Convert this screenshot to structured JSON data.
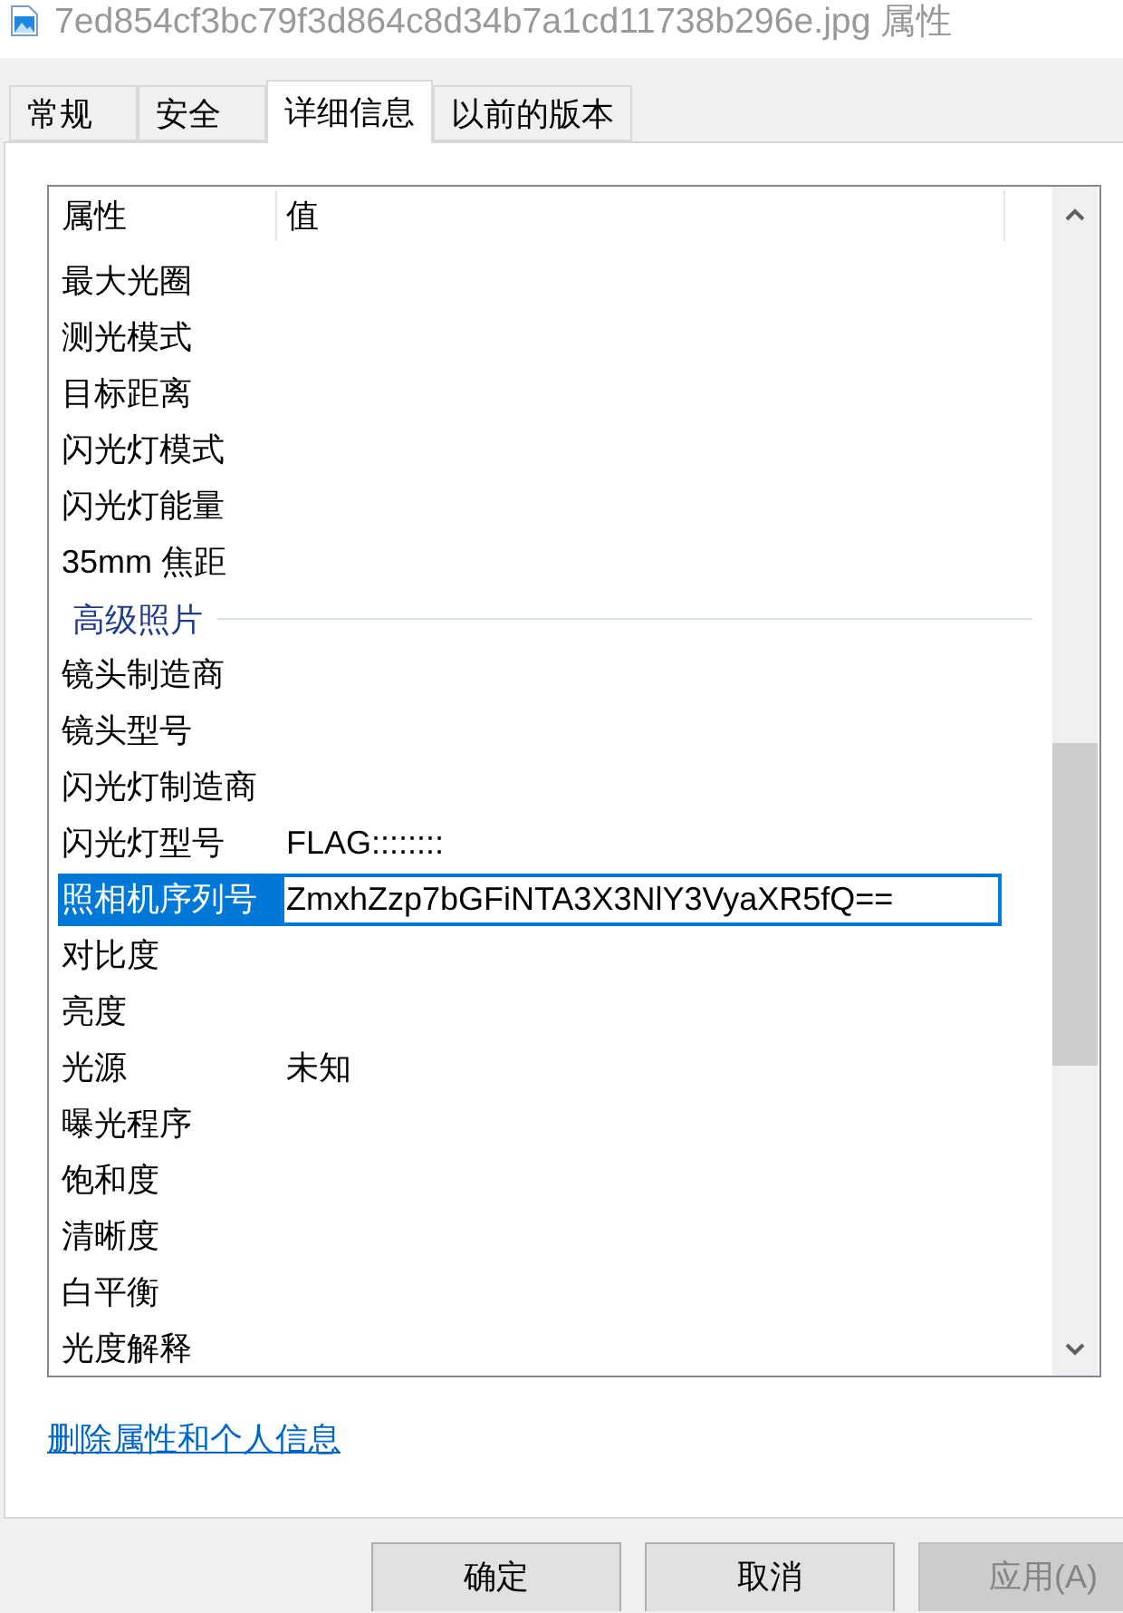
{
  "window": {
    "title": "7ed854cf3bc79f3d864c8d34b7a1cd11738b296e.jpg 属性"
  },
  "tabs": [
    {
      "label": "常规",
      "selected": false
    },
    {
      "label": "安全",
      "selected": false
    },
    {
      "label": "详细信息",
      "selected": true
    },
    {
      "label": "以前的版本",
      "selected": false
    }
  ],
  "property_list": {
    "columns": [
      "属性",
      "值"
    ],
    "rows": [
      {
        "kind": "property",
        "name": "最大光圈",
        "selected": false
      },
      {
        "kind": "property",
        "name": "测光模式",
        "selected": false
      },
      {
        "kind": "property",
        "name": "目标距离",
        "selected": false
      },
      {
        "kind": "property",
        "name": "闪光灯模式",
        "selected": false
      },
      {
        "kind": "property",
        "name": "闪光灯能量",
        "selected": false
      },
      {
        "kind": "property",
        "name": "35mm 焦距",
        "selected": false
      },
      {
        "kind": "group",
        "name": "高级照片"
      },
      {
        "kind": "property",
        "name": "镜头制造商",
        "selected": false
      },
      {
        "kind": "property",
        "name": "镜头型号",
        "selected": false
      },
      {
        "kind": "property",
        "name": "闪光灯制造商",
        "selected": false
      },
      {
        "kind": "property",
        "name": "闪光灯型号",
        "value": "FLAG::::::::",
        "selected": false
      },
      {
        "kind": "property",
        "name": "照相机序列号",
        "value": "ZmxhZzp7bGFiNTA3X3NlY3VyaXR5fQ==",
        "selected": true
      },
      {
        "kind": "property",
        "name": "对比度",
        "selected": false
      },
      {
        "kind": "property",
        "name": "亮度",
        "selected": false
      },
      {
        "kind": "property",
        "name": "光源",
        "value": "未知",
        "selected": false
      },
      {
        "kind": "property",
        "name": "曝光程序",
        "selected": false
      },
      {
        "kind": "property",
        "name": "饱和度",
        "selected": false
      },
      {
        "kind": "property",
        "name": "清晰度",
        "selected": false
      },
      {
        "kind": "property",
        "name": "白平衡",
        "selected": false
      },
      {
        "kind": "property",
        "name": "光度解释",
        "selected": false
      }
    ]
  },
  "link": "删除属性和个人信息",
  "buttons": [
    {
      "label": "确定",
      "disabled": false
    },
    {
      "label": "取消",
      "disabled": false
    },
    {
      "label": "应用(A)",
      "disabled": true
    }
  ]
}
